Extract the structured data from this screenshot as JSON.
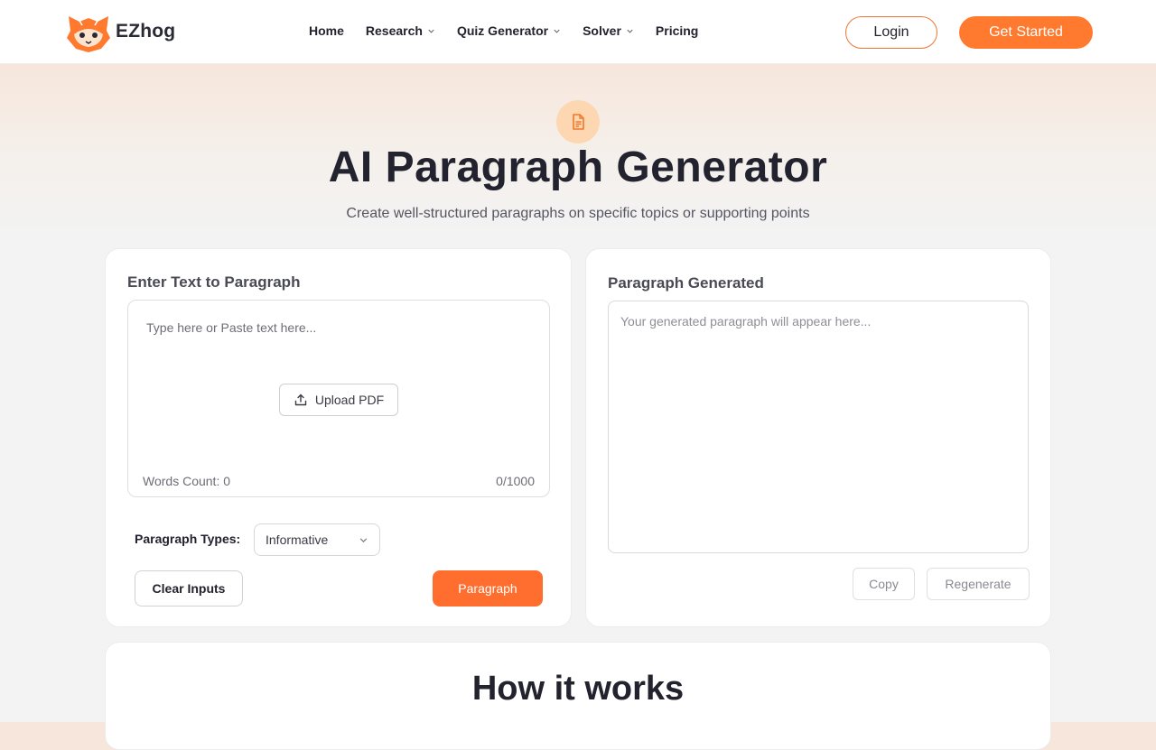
{
  "brand": {
    "name": "EZhog",
    "accent": "#ff7a2f"
  },
  "nav": {
    "items": [
      {
        "label": "Home",
        "dropdown": false
      },
      {
        "label": "Research",
        "dropdown": true
      },
      {
        "label": "Quiz Generator",
        "dropdown": true
      },
      {
        "label": "Solver",
        "dropdown": true
      },
      {
        "label": "Pricing",
        "dropdown": false
      }
    ],
    "login_label": "Login",
    "get_started_label": "Get Started"
  },
  "hero": {
    "icon": "document-icon",
    "title": "AI Paragraph Generator",
    "subtitle": "Create well-structured paragraphs on specific topics or supporting points"
  },
  "input_panel": {
    "title": "Enter Text to Paragraph",
    "placeholder": "Type here or Paste text here...",
    "upload_label": "Upload PDF",
    "words_count": "Words Count: 0",
    "char_count": "0/1000",
    "paragraph_types_label": "Paragraph Types:",
    "paragraph_type_value": "Informative",
    "clear_label": "Clear Inputs",
    "submit_label": "Paragraph"
  },
  "output_panel": {
    "title": "Paragraph Generated",
    "placeholder": "Your generated paragraph will appear here...",
    "copy_label": "Copy",
    "regenerate_label": "Regenerate"
  },
  "how_it_works": {
    "title": "How it works"
  }
}
